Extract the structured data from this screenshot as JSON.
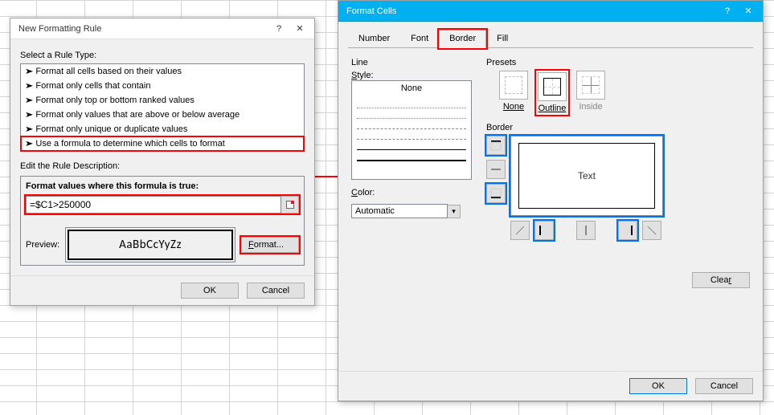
{
  "rule_dialog": {
    "title": "New Formatting Rule",
    "select_label": "Select a Rule Type:",
    "rules": [
      "Format all cells based on their values",
      "Format only cells that contain",
      "Format only top or bottom ranked values",
      "Format only values that are above or below average",
      "Format only unique or duplicate values",
      "Use a formula to determine which cells to format"
    ],
    "edit_label": "Edit the Rule Description:",
    "formula_label": "Format values where this formula is true:",
    "formula_value": "=$C1>250000",
    "preview_label": "Preview:",
    "preview_text": "AaBbCcYyZz",
    "format_btn": "Format...",
    "ok": "OK",
    "cancel": "Cancel"
  },
  "format_dialog": {
    "title": "Format Cells",
    "tabs": [
      "Number",
      "Font",
      "Border",
      "Fill"
    ],
    "active_tab": "Border",
    "line_label": "Line",
    "style_label": "Style:",
    "style_none": "None",
    "color_label": "Color:",
    "color_value": "Automatic",
    "presets_label": "Presets",
    "preset_none": "None",
    "preset_outline": "Outline",
    "preset_inside": "Inside",
    "border_label": "Border",
    "preview_text": "Text",
    "clear": "Clear",
    "ok": "OK",
    "cancel": "Cancel"
  }
}
